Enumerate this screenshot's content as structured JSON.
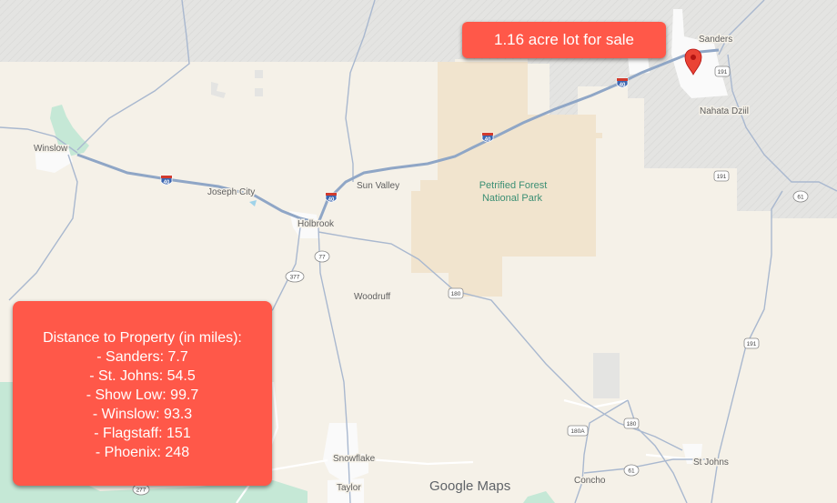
{
  "map": {
    "places": [
      {
        "id": "sanders",
        "name": "Sanders"
      },
      {
        "id": "nahata-dziil",
        "name": "Nahata Dziil"
      },
      {
        "id": "winslow",
        "name": "Winslow"
      },
      {
        "id": "joseph-city",
        "name": "Joseph City"
      },
      {
        "id": "sun-valley",
        "name": "Sun Valley"
      },
      {
        "id": "holbrook",
        "name": "Holbrook"
      },
      {
        "id": "woodruff",
        "name": "Woodruff"
      },
      {
        "id": "snowflake",
        "name": "Snowflake"
      },
      {
        "id": "taylor",
        "name": "Taylor"
      },
      {
        "id": "concho",
        "name": "Concho"
      },
      {
        "id": "st-johns",
        "name": "St Johns"
      }
    ],
    "park_label_line1": "Petrified Forest",
    "park_label_line2": "National Park",
    "road_shields": {
      "i40_a": "40",
      "i40_b": "40",
      "i40_c": "40",
      "i40_d": "40",
      "us191_a": "191",
      "us191_b": "191",
      "us191_c": "191",
      "us180_a": "180",
      "us180_b": "180",
      "us180a": "180A",
      "az61_a": "61",
      "az61_b": "61",
      "az77": "77",
      "az377": "377",
      "az277": "277"
    },
    "logo_text": "Google Maps",
    "colors": {
      "land": "#f5f1e8",
      "reservation": "#e4e4e2",
      "park": "#f1e4ce",
      "forest": "#c5e8d6",
      "highway": "#9db2d0",
      "callout": "#ff5849",
      "pin": "#ea4335"
    }
  },
  "callout_top": {
    "text": "1.16 acre lot for sale"
  },
  "distance_box": {
    "title": "Distance to Property (in miles):",
    "lines": [
      "- Sanders: 7.7",
      "- St. Johns: 54.5",
      "- Show Low: 99.7",
      "- Winslow: 93.3",
      "- Flagstaff: 151",
      "- Phoenix: 248"
    ]
  },
  "marker": {
    "icon": "map-pin-icon"
  }
}
